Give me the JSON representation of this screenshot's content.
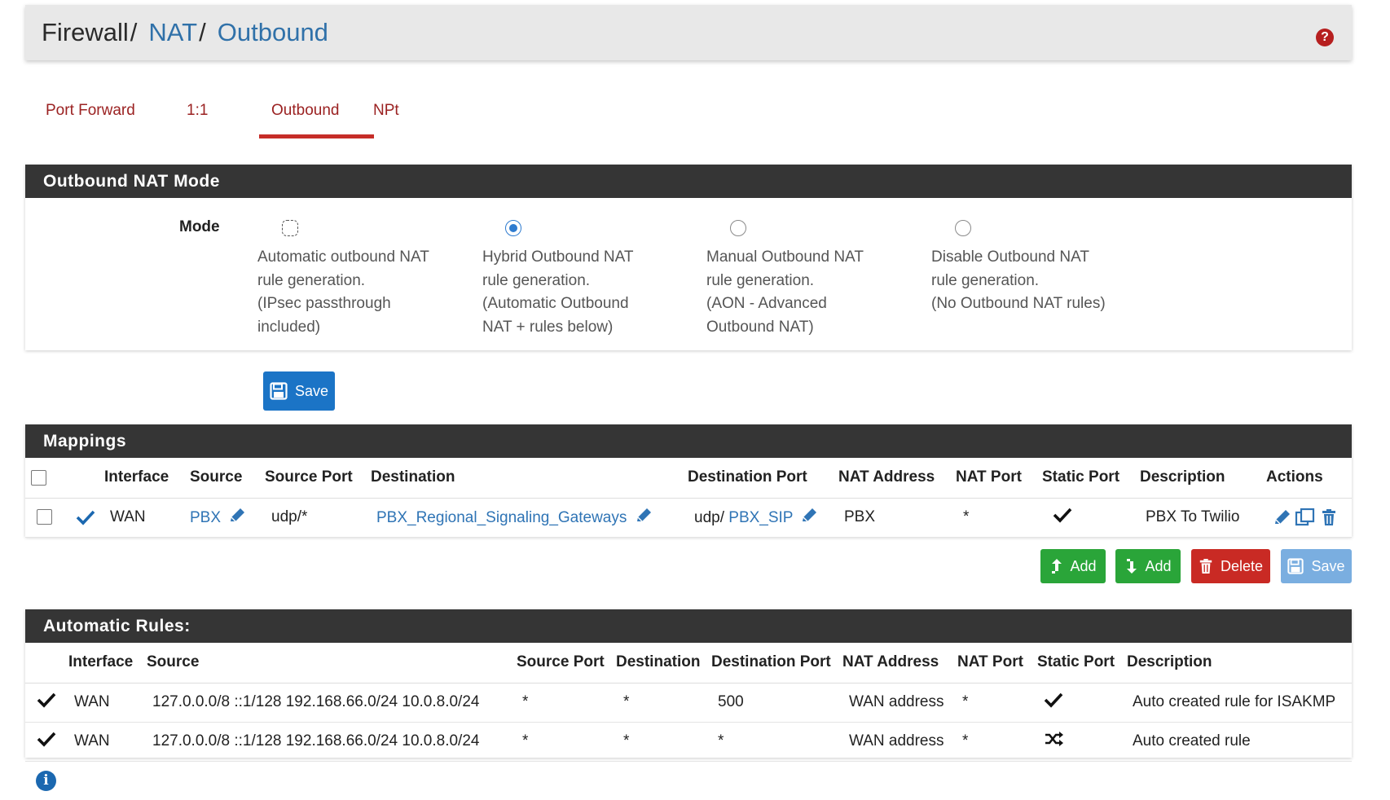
{
  "breadcrumb": {
    "items": [
      {
        "label": "Firewall",
        "sep": "/"
      },
      {
        "label": "NAT",
        "sep": "/"
      },
      {
        "label": "Outbound",
        "sep": ""
      }
    ],
    "help_icon": "question-circle-icon",
    "help_glyph": "?"
  },
  "tabs": [
    {
      "label": "Port Forward"
    },
    {
      "label": "1:1"
    },
    {
      "label": "Outbound",
      "active": true
    },
    {
      "label": "NPt"
    }
  ],
  "nat_mode": {
    "heading": "Outbound NAT Mode",
    "mode_label": "Mode",
    "options": [
      {
        "lines": [
          "Automatic outbound NAT",
          "rule generation.",
          "(IPsec passthrough",
          "included)"
        ],
        "checked": false
      },
      {
        "lines": [
          "Hybrid Outbound NAT",
          "rule generation.",
          "(Automatic Outbound",
          "NAT + rules below)"
        ],
        "checked": true
      },
      {
        "lines": [
          "Manual Outbound NAT",
          "rule generation.",
          "(AON - Advanced",
          "Outbound NAT)"
        ],
        "checked": false
      },
      {
        "lines": [
          "Disable Outbound NAT",
          "rule generation.",
          "(No Outbound NAT rules)"
        ],
        "checked": false
      }
    ],
    "save_label": "Save"
  },
  "mappings": {
    "heading": "Mappings",
    "columns": [
      "Interface",
      "Source",
      "Source Port",
      "Destination",
      "Destination Port",
      "NAT Address",
      "NAT Port",
      "Static Port",
      "Description",
      "Actions"
    ],
    "rows": [
      {
        "interface": "WAN",
        "source": "PBX",
        "source_port": "udp/*",
        "destination": "PBX_Regional_Signaling_Gateways",
        "dest_port_prefix": "udp/",
        "dest_port_alias": "PBX_SIP",
        "nat_address": "PBX",
        "nat_port": "*",
        "description": "PBX To Twilio"
      }
    ],
    "buttons": {
      "add_top": "Add",
      "add_bottom": "Add",
      "delete": "Delete",
      "save": "Save"
    }
  },
  "automatic_rules": {
    "heading": "Automatic Rules:",
    "columns": [
      "Interface",
      "Source",
      "Source Port",
      "Destination",
      "Destination Port",
      "NAT Address",
      "NAT Port",
      "Static Port",
      "Description"
    ],
    "rows": [
      {
        "interface": "WAN",
        "source": "127.0.0.0/8 ::1/128 192.168.66.0/24 10.0.8.0/24",
        "source_port": "*",
        "destination": "*",
        "destination_port": "500",
        "nat_address": "WAN address",
        "nat_port": "*",
        "static_icon": "check-icon",
        "description": "Auto created rule for ISAKMP"
      },
      {
        "interface": "WAN",
        "source": "127.0.0.0/8 ::1/128 192.168.66.0/24 10.0.8.0/24",
        "source_port": "*",
        "destination": "*",
        "destination_port": "*",
        "nat_address": "WAN address",
        "nat_port": "*",
        "static_icon": "shuffle-icon",
        "description": "Auto created rule"
      }
    ]
  },
  "info_glyph": "i",
  "colors": {
    "link": "#3071a9",
    "tab": "#9b2222",
    "heading_bg": "#353535",
    "success": "#2aa539",
    "danger": "#c92a24",
    "primary": "#1b74c6"
  }
}
